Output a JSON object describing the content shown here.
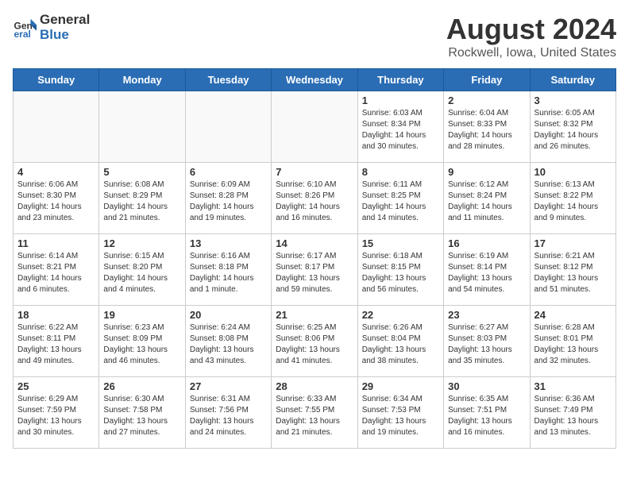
{
  "header": {
    "logo_general": "General",
    "logo_blue": "Blue",
    "title": "August 2024",
    "subtitle": "Rockwell, Iowa, United States"
  },
  "days_of_week": [
    "Sunday",
    "Monday",
    "Tuesday",
    "Wednesday",
    "Thursday",
    "Friday",
    "Saturday"
  ],
  "weeks": [
    [
      {
        "day": "",
        "info": ""
      },
      {
        "day": "",
        "info": ""
      },
      {
        "day": "",
        "info": ""
      },
      {
        "day": "",
        "info": ""
      },
      {
        "day": "1",
        "info": "Sunrise: 6:03 AM\nSunset: 8:34 PM\nDaylight: 14 hours\nand 30 minutes."
      },
      {
        "day": "2",
        "info": "Sunrise: 6:04 AM\nSunset: 8:33 PM\nDaylight: 14 hours\nand 28 minutes."
      },
      {
        "day": "3",
        "info": "Sunrise: 6:05 AM\nSunset: 8:32 PM\nDaylight: 14 hours\nand 26 minutes."
      }
    ],
    [
      {
        "day": "4",
        "info": "Sunrise: 6:06 AM\nSunset: 8:30 PM\nDaylight: 14 hours\nand 23 minutes."
      },
      {
        "day": "5",
        "info": "Sunrise: 6:08 AM\nSunset: 8:29 PM\nDaylight: 14 hours\nand 21 minutes."
      },
      {
        "day": "6",
        "info": "Sunrise: 6:09 AM\nSunset: 8:28 PM\nDaylight: 14 hours\nand 19 minutes."
      },
      {
        "day": "7",
        "info": "Sunrise: 6:10 AM\nSunset: 8:26 PM\nDaylight: 14 hours\nand 16 minutes."
      },
      {
        "day": "8",
        "info": "Sunrise: 6:11 AM\nSunset: 8:25 PM\nDaylight: 14 hours\nand 14 minutes."
      },
      {
        "day": "9",
        "info": "Sunrise: 6:12 AM\nSunset: 8:24 PM\nDaylight: 14 hours\nand 11 minutes."
      },
      {
        "day": "10",
        "info": "Sunrise: 6:13 AM\nSunset: 8:22 PM\nDaylight: 14 hours\nand 9 minutes."
      }
    ],
    [
      {
        "day": "11",
        "info": "Sunrise: 6:14 AM\nSunset: 8:21 PM\nDaylight: 14 hours\nand 6 minutes."
      },
      {
        "day": "12",
        "info": "Sunrise: 6:15 AM\nSunset: 8:20 PM\nDaylight: 14 hours\nand 4 minutes."
      },
      {
        "day": "13",
        "info": "Sunrise: 6:16 AM\nSunset: 8:18 PM\nDaylight: 14 hours\nand 1 minute."
      },
      {
        "day": "14",
        "info": "Sunrise: 6:17 AM\nSunset: 8:17 PM\nDaylight: 13 hours\nand 59 minutes."
      },
      {
        "day": "15",
        "info": "Sunrise: 6:18 AM\nSunset: 8:15 PM\nDaylight: 13 hours\nand 56 minutes."
      },
      {
        "day": "16",
        "info": "Sunrise: 6:19 AM\nSunset: 8:14 PM\nDaylight: 13 hours\nand 54 minutes."
      },
      {
        "day": "17",
        "info": "Sunrise: 6:21 AM\nSunset: 8:12 PM\nDaylight: 13 hours\nand 51 minutes."
      }
    ],
    [
      {
        "day": "18",
        "info": "Sunrise: 6:22 AM\nSunset: 8:11 PM\nDaylight: 13 hours\nand 49 minutes."
      },
      {
        "day": "19",
        "info": "Sunrise: 6:23 AM\nSunset: 8:09 PM\nDaylight: 13 hours\nand 46 minutes."
      },
      {
        "day": "20",
        "info": "Sunrise: 6:24 AM\nSunset: 8:08 PM\nDaylight: 13 hours\nand 43 minutes."
      },
      {
        "day": "21",
        "info": "Sunrise: 6:25 AM\nSunset: 8:06 PM\nDaylight: 13 hours\nand 41 minutes."
      },
      {
        "day": "22",
        "info": "Sunrise: 6:26 AM\nSunset: 8:04 PM\nDaylight: 13 hours\nand 38 minutes."
      },
      {
        "day": "23",
        "info": "Sunrise: 6:27 AM\nSunset: 8:03 PM\nDaylight: 13 hours\nand 35 minutes."
      },
      {
        "day": "24",
        "info": "Sunrise: 6:28 AM\nSunset: 8:01 PM\nDaylight: 13 hours\nand 32 minutes."
      }
    ],
    [
      {
        "day": "25",
        "info": "Sunrise: 6:29 AM\nSunset: 7:59 PM\nDaylight: 13 hours\nand 30 minutes."
      },
      {
        "day": "26",
        "info": "Sunrise: 6:30 AM\nSunset: 7:58 PM\nDaylight: 13 hours\nand 27 minutes."
      },
      {
        "day": "27",
        "info": "Sunrise: 6:31 AM\nSunset: 7:56 PM\nDaylight: 13 hours\nand 24 minutes."
      },
      {
        "day": "28",
        "info": "Sunrise: 6:33 AM\nSunset: 7:55 PM\nDaylight: 13 hours\nand 21 minutes."
      },
      {
        "day": "29",
        "info": "Sunrise: 6:34 AM\nSunset: 7:53 PM\nDaylight: 13 hours\nand 19 minutes."
      },
      {
        "day": "30",
        "info": "Sunrise: 6:35 AM\nSunset: 7:51 PM\nDaylight: 13 hours\nand 16 minutes."
      },
      {
        "day": "31",
        "info": "Sunrise: 6:36 AM\nSunset: 7:49 PM\nDaylight: 13 hours\nand 13 minutes."
      }
    ]
  ]
}
